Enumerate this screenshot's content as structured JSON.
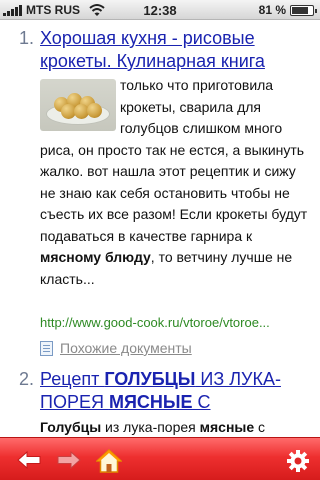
{
  "status_bar": {
    "carrier": "MTS RUS",
    "time": "12:38",
    "battery_text": "81 %",
    "battery_level": 0.81
  },
  "results": [
    {
      "number": "1.",
      "title_line1": "Хорошая кухня - рисовые",
      "title_line2": "крокеты. Кулинарная книга",
      "snippet_a": "только что приготовила крокеты, сварила для голубцов слишком много риса, он просто так не естся, а выкинуть жалко. вот нашла этот рецептик и сижу не знаю как себя остановить чтобы не съесть их все разом! Если крокеты будут подаваться в качестве гарнира к ",
      "snippet_bold": "мясному блюду",
      "snippet_b": ", то ветчину лучше не класть...",
      "url": "http://www.good-cook.ru/vtoroe/vtoroe...",
      "similar": "Похожие документы"
    },
    {
      "number": "2.",
      "title_p1": "Рецепт ",
      "title_b1": "ГОЛУБЦЫ",
      "title_p2": " ИЗ ЛУКА-",
      "title_p3": "ПОРЕЯ ",
      "title_b2": "МЯСНЫЕ",
      "title_p4": " С",
      "snippet_b1": "Голубцы",
      "snippet_p1": " из лука-порея ",
      "snippet_b2": "мясные",
      "snippet_p2": " с"
    }
  ],
  "toolbar": {
    "back_icon": "arrow-left-icon",
    "forward_icon": "arrow-right-icon",
    "home_icon": "home-icon",
    "settings_icon": "gear-icon"
  },
  "colors": {
    "link": "#1a23b0",
    "url": "#2e8a24",
    "toolbar": "#e62a2a"
  }
}
